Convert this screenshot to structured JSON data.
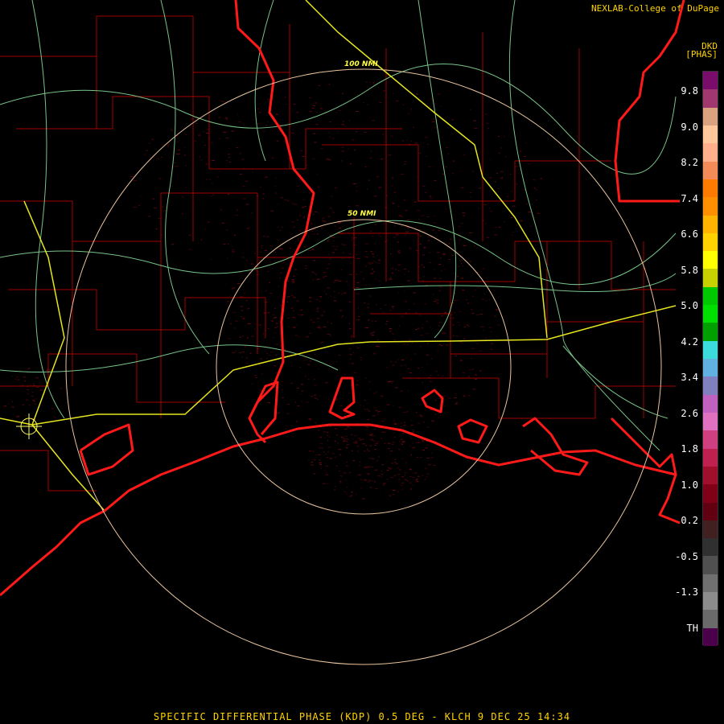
{
  "header": {
    "credit": "NEXLAB-College of DuPage",
    "product_code": "DKD",
    "product_unit": "[PHAS]"
  },
  "rings": [
    {
      "label": "50 NMI"
    },
    {
      "label": "100 NMI"
    }
  ],
  "legend": {
    "labels": [
      "9.8",
      "9.0",
      "8.2",
      "7.4",
      "6.6",
      "5.8",
      "5.0",
      "4.2",
      "3.4",
      "2.6",
      "1.8",
      "1.0",
      "0.2",
      "-0.5",
      "-1.3",
      "TH"
    ],
    "colors": [
      "#7a0d6b",
      "#a0376f",
      "#d9a37f",
      "#ffc79a",
      "#ffb08a",
      "#f28b57",
      "#ff7a00",
      "#ff8f00",
      "#ffb400",
      "#ffd200",
      "#ffff00",
      "#c8d000",
      "#00c800",
      "#00e000",
      "#00a000",
      "#3cdcdc",
      "#60b0e0",
      "#8080c0",
      "#c060c0",
      "#e070c0",
      "#d04080",
      "#c02050",
      "#a0102c",
      "#800018",
      "#600010",
      "#402020",
      "#303030",
      "#505050",
      "#707070",
      "#8c8c8c",
      "#6a6a6a",
      "#4a004a"
    ]
  },
  "colors": {
    "state_border": "#ff1a1a",
    "county_border": "#b40000",
    "highway_major": "#e6e61e",
    "highway_minor": "#8ee6a0",
    "range_ring": "#e8c39e",
    "echo": "#7a0a14"
  },
  "footer": {
    "caption": "SPECIFIC DIFFERENTIAL PHASE (KDP) 0.5 DEG - KLCH 9 DEC 25 14:34"
  }
}
